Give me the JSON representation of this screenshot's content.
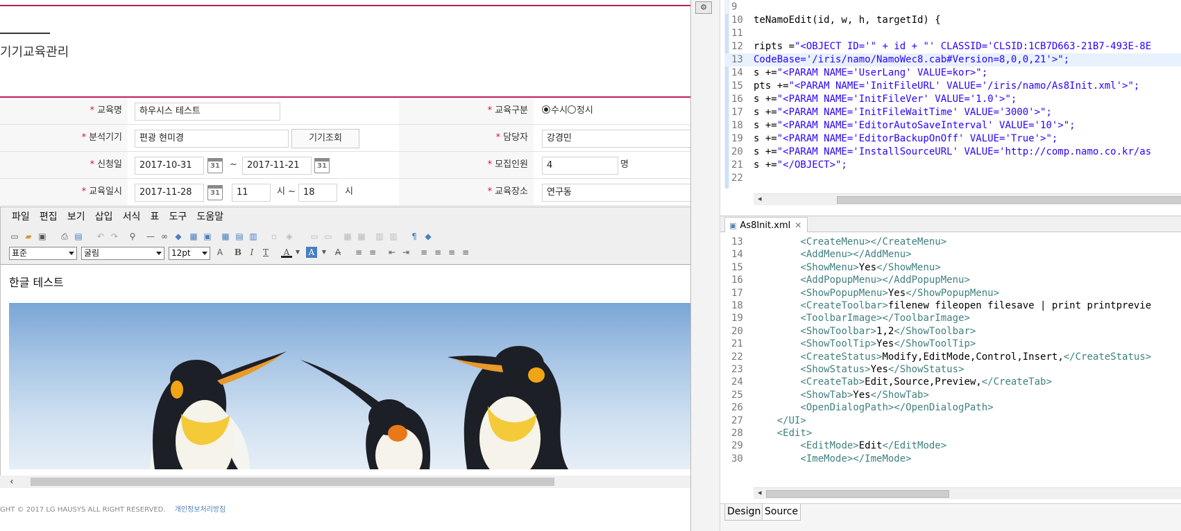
{
  "left": {
    "page_title": "기기교육관리",
    "form": {
      "row1": {
        "label1": "교육명",
        "value1": "하우시스 테스트",
        "label2": "교육구분",
        "radio1": "수시",
        "radio2": "정시"
      },
      "row2": {
        "label1": "분석기기",
        "value1": "편광 현미경",
        "button": "기기조회",
        "label2": "담당자",
        "value2": "강경민"
      },
      "row3": {
        "label1": "신청일",
        "date_from": "2017-10-31",
        "tilde": "~",
        "date_to": "2017-11-21",
        "label2": "모집인원",
        "value2": "4",
        "unit": "명"
      },
      "row4": {
        "label1": "교육일시",
        "date": "2017-11-28",
        "hour_from": "11",
        "sep": "시 ~",
        "hour_to": "18",
        "unit": "시",
        "label2": "교육장소",
        "value2": "연구동"
      },
      "required_mark": "*"
    },
    "editor": {
      "menu": [
        "파일",
        "편집",
        "보기",
        "삽입",
        "서식",
        "표",
        "도구",
        "도움말"
      ],
      "style_select": "표준",
      "font_select": "굴림",
      "size_select": "12pt",
      "body_text": "한글 테스트"
    },
    "footer": {
      "copyright": "GHT © 2017 LG HAUSYS ALL RIGHT RESERVED.",
      "privacy_link": "개인정보처리방침"
    }
  },
  "right": {
    "code_lines": [
      {
        "num": "9",
        "text": ""
      },
      {
        "num": "10",
        "text": "teNamoEdit(id, w, h, targetId) {"
      },
      {
        "num": "11",
        "text": ""
      },
      {
        "num": "12",
        "pre": "ripts =",
        "str": "\"<OBJECT ID='\" + id + \"' CLASSID='CLSID:1CB7D663-21B7-493E-8E"
      },
      {
        "num": "13",
        "str": "CodeBase='/iris/namo/NamoWec8.cab#Version=8,0,0,21'>\";"
      },
      {
        "num": "14",
        "pre": "s +=",
        "str": "\"<PARAM NAME='UserLang' VALUE=kor>\";"
      },
      {
        "num": "15",
        "pre": "pts +=",
        "str": "\"<PARAM NAME='InitFileURL' VALUE='/iris/namo/As8Init.xml'>\";"
      },
      {
        "num": "16",
        "pre": "s +=",
        "str": "\"<PARAM NAME='InitFileVer' VALUE='1.0'>\";"
      },
      {
        "num": "17",
        "pre": "s +=",
        "str": "\"<PARAM NAME='InitFileWaitTime' VALUE='3000'>\";"
      },
      {
        "num": "18",
        "pre": "s +=",
        "str": "\"<PARAM NAME='EditorAutoSaveInterval' VALUE='10'>\";"
      },
      {
        "num": "19",
        "pre": "s +=",
        "str": "\"<PARAM NAME='EditorBackupOnOff' VALUE='True'>\";"
      },
      {
        "num": "20",
        "pre": "s +=",
        "str": "\"<PARAM NAME='InstallSourceURL' VALUE='http://comp.namo.co.kr/as"
      },
      {
        "num": "21",
        "pre": "s +=",
        "str": "\"</OBJECT>\";"
      },
      {
        "num": "22",
        "text": ""
      }
    ],
    "xml_tab": "As8Init.xml",
    "xml_lines": [
      {
        "num": "13",
        "indent": "        ",
        "open": "<CreateMenu>",
        "val": "",
        "close": "</CreateMenu>"
      },
      {
        "num": "14",
        "indent": "        ",
        "open": "<AddMenu>",
        "val": "",
        "close": "</AddMenu>"
      },
      {
        "num": "15",
        "indent": "        ",
        "open": "<ShowMenu>",
        "val": "Yes",
        "close": "</ShowMenu>"
      },
      {
        "num": "16",
        "indent": "        ",
        "open": "<AddPopupMenu>",
        "val": "",
        "close": "</AddPopupMenu>"
      },
      {
        "num": "17",
        "indent": "        ",
        "open": "<ShowPopupMenu>",
        "val": "Yes",
        "close": "</ShowPopupMenu>"
      },
      {
        "num": "18",
        "indent": "        ",
        "open": "<CreateToolbar>",
        "val": "filenew fileopen filesave | print printprevie",
        "close": ""
      },
      {
        "num": "19",
        "indent": "        ",
        "open": "<ToolbarImage>",
        "val": "",
        "close": "</ToolbarImage>"
      },
      {
        "num": "20",
        "indent": "        ",
        "open": "<ShowToolbar>",
        "val": "1,2",
        "close": "</ShowToolbar>"
      },
      {
        "num": "21",
        "indent": "        ",
        "open": "<ShowToolTip>",
        "val": "Yes",
        "close": "</ShowToolTip>"
      },
      {
        "num": "22",
        "indent": "        ",
        "open": "<CreateStatus>",
        "val": "Modify,EditMode,Control,Insert,",
        "close": "</CreateStatus>"
      },
      {
        "num": "23",
        "indent": "        ",
        "open": "<ShowStatus>",
        "val": "Yes",
        "close": "</ShowStatus>"
      },
      {
        "num": "24",
        "indent": "        ",
        "open": "<CreateTab>",
        "val": "Edit,Source,Preview,",
        "close": "</CreateTab>"
      },
      {
        "num": "25",
        "indent": "        ",
        "open": "<ShowTab>",
        "val": "Yes",
        "close": "</ShowTab>"
      },
      {
        "num": "26",
        "indent": "        ",
        "open": "<OpenDialogPath>",
        "val": "",
        "close": "</OpenDialogPath>"
      },
      {
        "num": "27",
        "indent": "    ",
        "open": "</UI>",
        "val": "",
        "close": ""
      },
      {
        "num": "28",
        "indent": "    ",
        "open": "<Edit>",
        "val": "",
        "close": ""
      },
      {
        "num": "29",
        "indent": "        ",
        "open": "<EditMode>",
        "val": "Edit",
        "close": "</EditMode>"
      },
      {
        "num": "30",
        "indent": "        ",
        "open": "<ImeMode>",
        "val": "",
        "close": "</ImeMode>"
      }
    ],
    "bottom_tabs": {
      "design": "Design",
      "source": "Source"
    }
  },
  "colors": {
    "accent": "#c4185a",
    "required": "#d0104c",
    "xml_tag": "#3f7f7f",
    "string": "#2a00ff"
  }
}
